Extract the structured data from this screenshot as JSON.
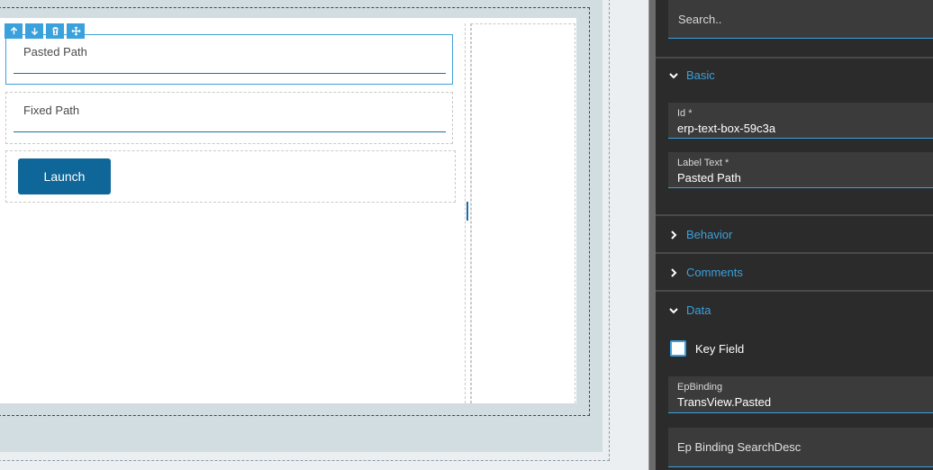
{
  "canvas": {
    "toolbar": {
      "move_up_icon": "arrow-up-icon",
      "move_down_icon": "arrow-down-icon",
      "delete_icon": "trash-icon",
      "drag_icon": "move-icon"
    },
    "fields": [
      {
        "label": "Pasted Path"
      },
      {
        "label": "Fixed Path"
      }
    ],
    "launch_button_label": "Launch"
  },
  "panel": {
    "search_placeholder": "Search..",
    "sections": {
      "basic": {
        "title": "Basic",
        "expanded": true,
        "id_label": "Id *",
        "id_value": "erp-text-box-59c3a",
        "label_text_label": "Label Text *",
        "label_text_value": "Pasted Path"
      },
      "behavior": {
        "title": "Behavior",
        "expanded": false
      },
      "comments": {
        "title": "Comments",
        "expanded": false
      },
      "data": {
        "title": "Data",
        "expanded": true,
        "key_field_label": "Key Field",
        "key_field_checked": false,
        "ep_binding_label": "EpBinding",
        "ep_binding_value": "TransView.Pasted",
        "ep_binding_search_placeholder": "Ep Binding SearchDesc"
      }
    }
  },
  "colors": {
    "accent": "#3aa1dc",
    "button": "#0f6699",
    "panel_bg": "#2b2b2b",
    "field_bg": "#3b3b3b",
    "canvas_bg": "#d2dde2"
  }
}
